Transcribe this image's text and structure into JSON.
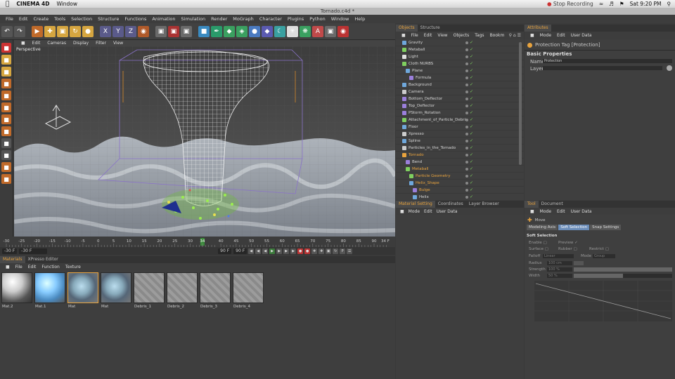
{
  "mac_menubar": {
    "app_name": "CINEMA 4D",
    "window_menu": "Window",
    "recording": "Stop Recording",
    "clock": "Sat 9:20 PM"
  },
  "title": "Tornado.c4d *",
  "menu": [
    "File",
    "Edit",
    "Create",
    "Tools",
    "Selection",
    "Structure",
    "Functions",
    "Animation",
    "Simulation",
    "Render",
    "MoGraph",
    "Character",
    "Plugins",
    "Python",
    "Window",
    "Help"
  ],
  "toolbar": {
    "buttons": [
      "undo-icon",
      "redo-icon",
      "select-icon",
      "move-icon",
      "scale-icon",
      "rotate-icon",
      "live-select-icon",
      "x-axis-icon",
      "y-axis-icon",
      "z-axis-icon",
      "coord-icon",
      "render-view-icon",
      "render-picture-icon",
      "edit-render-icon",
      "cube-icon",
      "pen-icon",
      "subdivision-icon",
      "array-icon",
      "metaball-icon",
      "deformer-icon",
      "scene-icon",
      "light-icon",
      "hair-icon",
      "character-icon",
      "camera-icon",
      "stop-icon"
    ]
  },
  "left_toolbar": [
    "make-editable-icon",
    "model-icon",
    "texture-icon",
    "axis-icon",
    "points-icon",
    "edges-icon",
    "polygons-icon",
    "uv-icon",
    "snap-icon",
    "workplane-icon",
    "locked-icon",
    "sculpt-icon"
  ],
  "viewport": {
    "menu": [
      "Edit",
      "Cameras",
      "Display",
      "Filter",
      "View"
    ],
    "label": "Perspective"
  },
  "timeline": {
    "ticks": [
      "-30",
      "-25",
      "-20",
      "-15",
      "-10",
      "-5",
      "0",
      "5",
      "10",
      "15",
      "20",
      "25",
      "30",
      "34",
      "40",
      "45",
      "50",
      "55",
      "60",
      "65",
      "70",
      "75",
      "80",
      "85",
      "90"
    ],
    "current_frame": "34",
    "end_label": "34 F"
  },
  "transport": {
    "start": "-30 F",
    "min": "-30 F",
    "max": "90 F",
    "end": "90 F"
  },
  "materials": {
    "tabs": [
      "Materials",
      "XPresso Editor"
    ],
    "menu": [
      "File",
      "Edit",
      "Function",
      "Texture"
    ],
    "items": [
      {
        "label": "Mat.2",
        "kind": "white"
      },
      {
        "label": "Mat.1",
        "kind": "blue"
      },
      {
        "label": "Mat",
        "kind": "glass-sel"
      },
      {
        "label": "Mat",
        "kind": "glass"
      },
      {
        "label": "Debris_1",
        "kind": "noise"
      },
      {
        "label": "Debris_2",
        "kind": "noise"
      },
      {
        "label": "Debris_3",
        "kind": "noise"
      },
      {
        "label": "Debris_4",
        "kind": "noise"
      }
    ]
  },
  "objects": {
    "tabs": [
      "Objects",
      "Structure"
    ],
    "menu": [
      "File",
      "Edit",
      "View",
      "Objects",
      "Tags",
      "Bookm"
    ],
    "rows": [
      {
        "name": "Gravity",
        "indent": 0,
        "color": "#6fa8dc",
        "hl": false
      },
      {
        "name": "Metaball",
        "indent": 0,
        "color": "#7fcf5f",
        "hl": false
      },
      {
        "name": "Light",
        "indent": 0,
        "color": "#e0e0e0",
        "hl": false
      },
      {
        "name": "Cloth NURBS",
        "indent": 0,
        "color": "#7fcf5f",
        "hl": false
      },
      {
        "name": "Plane",
        "indent": 1,
        "color": "#6fa8dc",
        "hl": false
      },
      {
        "name": "Formula",
        "indent": 2,
        "color": "#9b7fdc",
        "hl": false
      },
      {
        "name": "Background",
        "indent": 0,
        "color": "#6fa8dc",
        "hl": false
      },
      {
        "name": "Camera",
        "indent": 0,
        "color": "#cccccc",
        "hl": false
      },
      {
        "name": "Bottom_Deflector",
        "indent": 0,
        "color": "#9b7fdc",
        "hl": false
      },
      {
        "name": "Top_Deflector",
        "indent": 0,
        "color": "#9b7fdc",
        "hl": false
      },
      {
        "name": "PStorm_Rotation",
        "indent": 0,
        "color": "#9b7fdc",
        "hl": false
      },
      {
        "name": "Attachment_of_Particle_Debris",
        "indent": 0,
        "color": "#7fcf5f",
        "hl": false
      },
      {
        "name": "Floor",
        "indent": 0,
        "color": "#6fa8dc",
        "hl": false
      },
      {
        "name": "Xpresso",
        "indent": 0,
        "color": "#cccccc",
        "hl": false
      },
      {
        "name": "Spline",
        "indent": 0,
        "color": "#6fa8dc",
        "hl": false
      },
      {
        "name": "Particles_in_the_Tornado",
        "indent": 0,
        "color": "#cccccc",
        "hl": false
      },
      {
        "name": "Tornado",
        "indent": 0,
        "color": "#e8a33e",
        "hl": true
      },
      {
        "name": "Bend",
        "indent": 1,
        "color": "#9b7fdc",
        "hl": false
      },
      {
        "name": "Metaball",
        "indent": 1,
        "color": "#7fcf5f",
        "hl": true
      },
      {
        "name": "Particle Geometry",
        "indent": 2,
        "color": "#7fcf5f",
        "hl": true
      },
      {
        "name": "Helix_Shape",
        "indent": 2,
        "color": "#6fa8dc",
        "hl": true
      },
      {
        "name": "Bulge",
        "indent": 3,
        "color": "#9b7fdc",
        "hl": true
      },
      {
        "name": "Helix",
        "indent": 3,
        "color": "#6fa8dc",
        "hl": false
      }
    ]
  },
  "material_setting": {
    "tabs": [
      "Material Setting",
      "Coordinates",
      "Layer Browser"
    ],
    "menu": [
      "Mode",
      "Edit",
      "User Data"
    ]
  },
  "attributes": {
    "tabs": [
      "Attributes"
    ],
    "menu": [
      "Mode",
      "Edit",
      "User Data"
    ],
    "tag_title": "Protection Tag [Protection]",
    "section": "Basic Properties",
    "name_label": "Name",
    "name_value": "Protection",
    "layer_label": "Layer"
  },
  "tool": {
    "tabs": [
      "Tool",
      "Document"
    ],
    "menu": [
      "Mode",
      "Edit",
      "User Data"
    ],
    "tool_name": "Move",
    "subtabs": [
      "Modeling Axis",
      "Soft Selection",
      "Snap Settings"
    ],
    "section": "Soft Selection",
    "enable": "Enable",
    "preview": "Preview",
    "surface": "Surface",
    "rubber": "Rubber",
    "restrict": "Restrict",
    "falloff_label": "Falloff",
    "falloff_value": "Linear",
    "mode_label": "Mode",
    "mode_value": "Group",
    "radius_label": "Radius",
    "radius_value": "100 cm",
    "strength_label": "Strength",
    "strength_value": "100 %",
    "strength_level": 1.0,
    "width_label": "Width",
    "width_value": "50 %",
    "width_level": 0.5
  }
}
